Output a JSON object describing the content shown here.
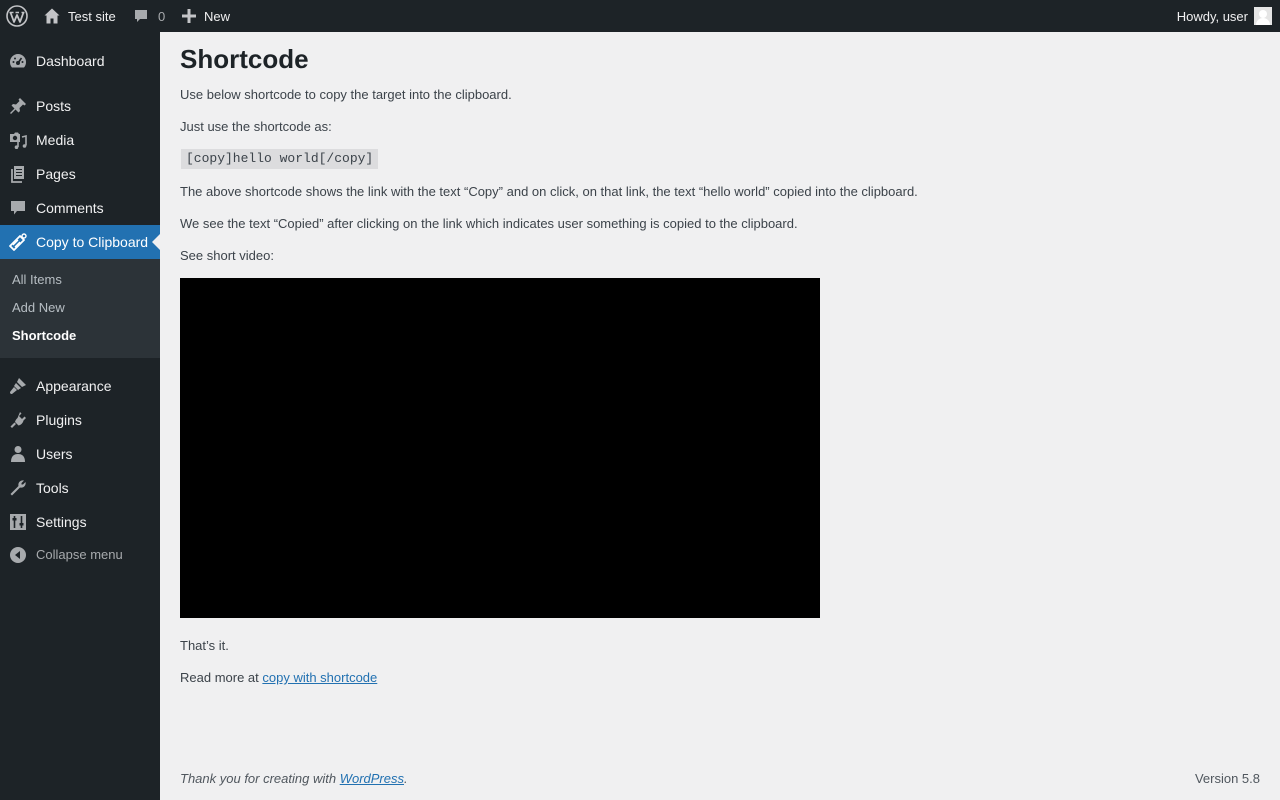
{
  "adminbar": {
    "site_name": "Test site",
    "comments_count": "0",
    "new_label": "New",
    "howdy": "Howdy, user"
  },
  "sidebar": {
    "items": [
      {
        "label": "Dashboard",
        "icon": "dashboard-icon"
      },
      {
        "label": "Posts",
        "icon": "pushpin-icon"
      },
      {
        "label": "Media",
        "icon": "media-icon"
      },
      {
        "label": "Pages",
        "icon": "pages-icon"
      },
      {
        "label": "Comments",
        "icon": "comment-icon"
      },
      {
        "label": "Copy to Clipboard",
        "icon": "clipboard-icon",
        "current": true
      },
      {
        "label": "Appearance",
        "icon": "paintbrush-icon"
      },
      {
        "label": "Plugins",
        "icon": "plugin-icon"
      },
      {
        "label": "Users",
        "icon": "user-icon"
      },
      {
        "label": "Tools",
        "icon": "wrench-icon"
      },
      {
        "label": "Settings",
        "icon": "settings-icon"
      }
    ],
    "submenu": [
      {
        "label": "All Items"
      },
      {
        "label": "Add New"
      },
      {
        "label": "Shortcode",
        "current": true
      }
    ],
    "collapse_label": "Collapse menu"
  },
  "main": {
    "title": "Shortcode",
    "intro": "Use below shortcode to copy the target into the clipboard.",
    "usage_label": "Just use the shortcode as:",
    "code": "[copy]hello world[/copy]",
    "description": "The above shortcode shows the link with the text “Copy” and on click, on that link, the text “hello world” copied into the clipboard.",
    "copied_note": "We see the text “Copied” after clicking on the link which indicates user something is copied to the clipboard.",
    "video_label": "See short video:",
    "thats_it": "That’s it.",
    "read_more_prefix": "Read more at ",
    "read_more_link": "copy with shortcode"
  },
  "footer": {
    "thanks_prefix": "Thank you for creating with ",
    "thanks_link": "WordPress",
    "thanks_suffix": ".",
    "version": "Version 5.8"
  },
  "colors": {
    "adminbar_bg": "#1d2327",
    "accent": "#2271b1",
    "content_bg": "#f0f0f1"
  }
}
